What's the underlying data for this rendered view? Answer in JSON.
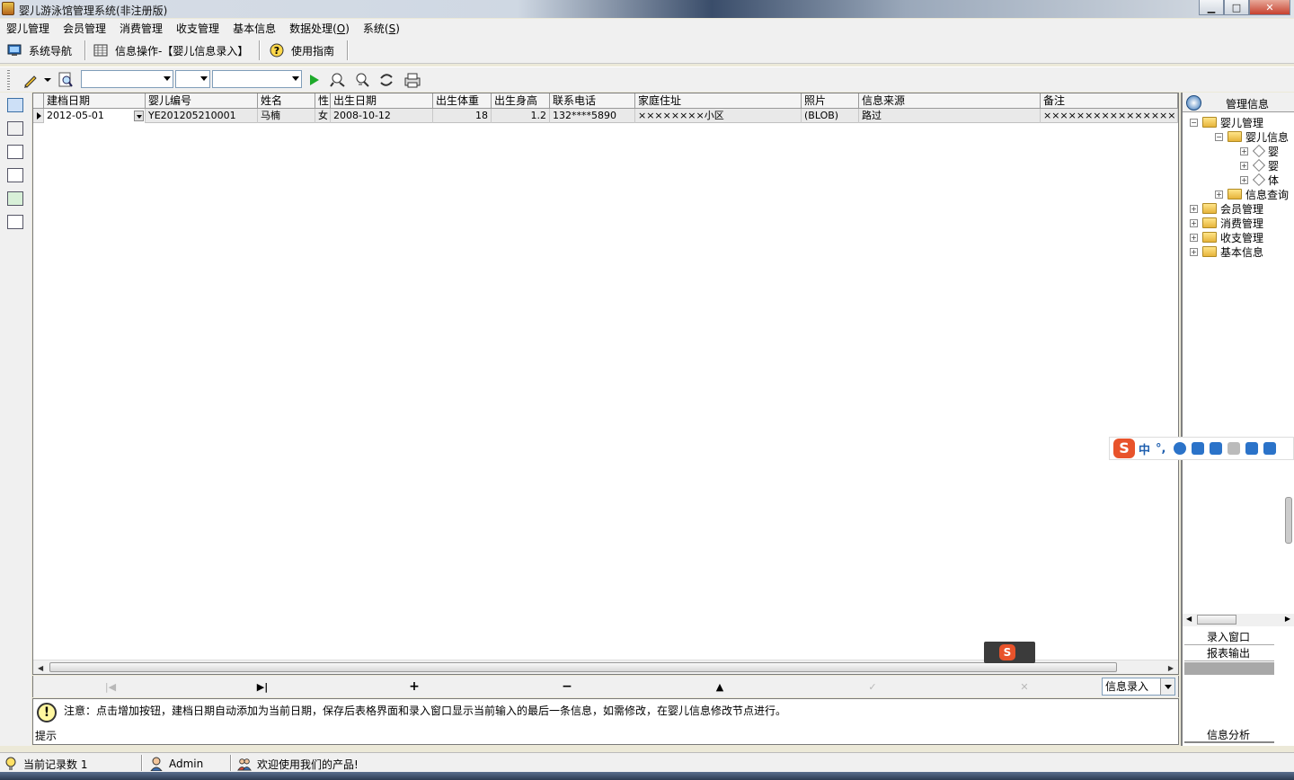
{
  "window": {
    "title": "婴儿游泳馆管理系统(非注册版)",
    "controls": [
      "minimize",
      "maximize",
      "close"
    ]
  },
  "menu": [
    {
      "label": "婴儿管理"
    },
    {
      "label": "会员管理"
    },
    {
      "label": "消费管理"
    },
    {
      "label": "收支管理"
    },
    {
      "label": "基本信息"
    },
    {
      "label_prefix": "数据处理(",
      "accel": "O",
      "label_suffix": ")"
    },
    {
      "label_prefix": "系统(",
      "accel": "S",
      "label_suffix": ")"
    }
  ],
  "nav_tabs": [
    {
      "label": "系统导航",
      "icon": "monitor-icon"
    },
    {
      "label": "信息操作-【婴儿信息录入】",
      "icon": "grid-icon"
    },
    {
      "label": "使用指南",
      "icon": "help-icon"
    }
  ],
  "toolbar": {
    "icons": [
      "edit-icon",
      "preview-icon",
      "play-icon",
      "find-icon",
      "find-next-icon",
      "refresh-icon",
      "print-icon"
    ]
  },
  "grid": {
    "columns": [
      "建档日期",
      "婴儿编号",
      "姓名",
      "性",
      "出生日期",
      "出生体重",
      "出生身高",
      "联系电话",
      "家庭住址",
      "照片",
      "信息来源",
      "备注"
    ],
    "rows": [
      [
        "2012-05-01",
        "YE201205210001",
        "马楠",
        "女",
        "2008-10-12",
        "18",
        "1.2",
        "132****5890",
        "××××××××小区",
        "(BLOB)",
        "路过",
        "××××××××××××××××"
      ]
    ]
  },
  "navigator": {
    "mode_value": "信息录入"
  },
  "tip": {
    "label": "提示",
    "text": "注意：点击增加按钮，建档日期自动添加为当前日期，保存后表格界面和录入窗口显示当前输入的最后一条信息，如需修改，在婴儿信息修改节点进行。"
  },
  "right_panel": {
    "title": "管理信息",
    "tree": [
      {
        "label": "婴儿管理",
        "level": 0,
        "expanded": true
      },
      {
        "label": "婴儿信息",
        "level": 1,
        "expanded": true
      },
      {
        "label": "婴",
        "level": 2,
        "leaf": true
      },
      {
        "label": "婴",
        "level": 2,
        "leaf": true
      },
      {
        "label": "体",
        "level": 2,
        "leaf": true
      },
      {
        "label": "信息查询",
        "level": 1,
        "expanded": false
      },
      {
        "label": "会员管理",
        "level": 0,
        "expanded": false
      },
      {
        "label": "消费管理",
        "level": 0,
        "expanded": false
      },
      {
        "label": "收支管理",
        "level": 0,
        "expanded": false
      },
      {
        "label": "基本信息",
        "level": 0,
        "expanded": false
      }
    ],
    "buttons": [
      "录入窗口",
      "报表输出",
      "",
      "信息分析"
    ]
  },
  "statusbar": {
    "record_count": "当前记录数 1",
    "user": "Admin",
    "welcome": "欢迎使用我们的产品!"
  },
  "ime": {
    "logo": "S",
    "mode": "中",
    "punct": "°,"
  },
  "colors": {
    "accent": "#3a6ea5",
    "row_bg": "#e9e9e9",
    "ime_brand": "#e8532b"
  }
}
